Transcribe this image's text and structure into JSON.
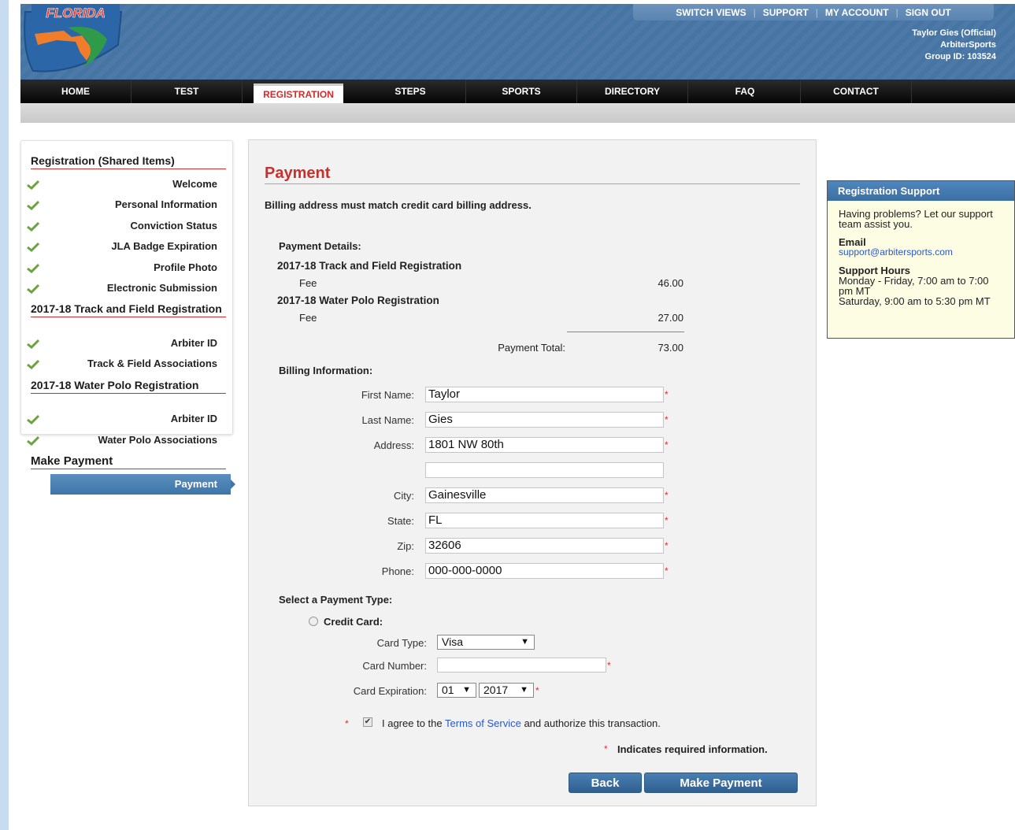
{
  "header": {
    "top_menu": [
      "SWITCH VIEWS",
      "SUPPORT",
      "MY ACCOUNT",
      "SIGN OUT"
    ],
    "user_name": "Taylor Gies (Official)",
    "org": "ArbiterSports",
    "group_id": "Group ID: 103524",
    "logo_text": "FLORIDA"
  },
  "nav": [
    "HOME",
    "TEST",
    "REGISTRATION",
    "STEPS",
    "SPORTS",
    "DIRECTORY",
    "FAQ",
    "CONTACT"
  ],
  "sidebar": {
    "section1": "Registration (Shared Items)",
    "shared_items": [
      "Welcome",
      "Personal Information",
      "Conviction Status",
      "JLA Badge Expiration",
      "Profile Photo",
      "Electronic Submission"
    ],
    "section2": "2017-18 Track and Field Registration",
    "track_items": [
      "Arbiter ID",
      "Track & Field Associations"
    ],
    "section3": "2017-18 Water Polo Registration",
    "polo_items": [
      "Arbiter ID",
      "Water Polo Associations"
    ],
    "section4": "Make Payment",
    "active_item": "Payment"
  },
  "main": {
    "title": "Payment",
    "notice": "Billing address must match credit card billing address.",
    "details_label": "Payment Details:",
    "item1": "2017-18 Track and Field Registration",
    "item1_fee_label": "Fee",
    "item1_fee": "46.00",
    "item2": "2017-18 Water Polo Registration",
    "item2_fee_label": "Fee",
    "item2_fee": "27.00",
    "total_label": "Payment Total:",
    "total": "73.00",
    "billing_label": "Billing Information:",
    "fields": {
      "first_name_label": "First Name:",
      "first_name": "Taylor",
      "last_name_label": "Last Name:",
      "last_name": "Gies",
      "address_label": "Address:",
      "address": "1801 NW 80th",
      "address2": "",
      "city_label": "City:",
      "city": "Gainesville",
      "state_label": "State:",
      "state": "FL",
      "zip_label": "Zip:",
      "zip": "32606",
      "phone_label": "Phone:",
      "phone": "000-000-0000"
    },
    "payment_type_label": "Select a Payment Type:",
    "credit_card_label": "Credit Card:",
    "card_type_label": "Card Type:",
    "card_type": "Visa",
    "card_number_label": "Card Number:",
    "card_number": "",
    "card_exp_label": "Card Expiration:",
    "exp_month": "01",
    "exp_year": "2017",
    "agree_prefix": "I agree to the",
    "terms_link": "Terms of Service",
    "agree_suffix": "and authorize this transaction.",
    "required_note": "Indicates required information.",
    "back_button": "Back",
    "pay_button": "Make Payment",
    "required_mark": "*"
  },
  "support": {
    "title": "Registration Support",
    "intro": "Having problems? Let our support team assist you.",
    "email_label": "Email",
    "email": "support@arbitersports.com",
    "hours_label": "Support Hours",
    "hours_weekday": "Monday - Friday, 7:00 am to 7:00 pm MT",
    "hours_sat": "Saturday, 9:00 am to 5:30 pm MT"
  },
  "colors": {
    "accent_red": "#c9302c",
    "nav_blue": "#3f75a8",
    "link": "#2a58c9"
  }
}
